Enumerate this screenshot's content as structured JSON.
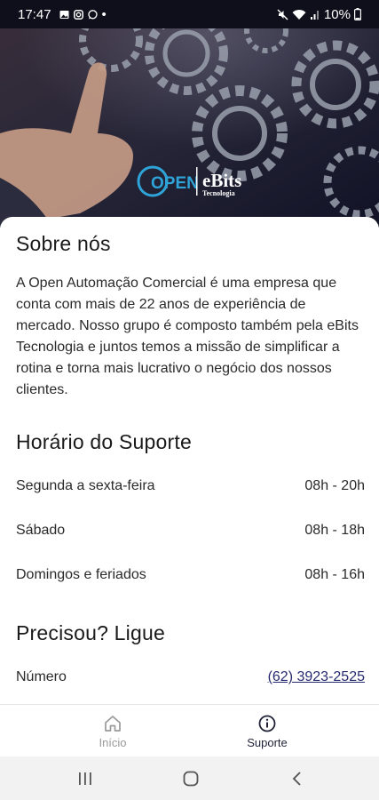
{
  "status_bar": {
    "time": "17:47",
    "dot": "•",
    "battery": "10%",
    "icons": [
      "image-icon",
      "instagram-icon",
      "whatsapp-icon",
      "mute-icon",
      "wifi-icon",
      "signal-icon",
      "battery-icon"
    ]
  },
  "hero": {
    "brand_open": "OPEN",
    "brand_ebits": "eBits",
    "brand_ebits_sub": "Tecnologia"
  },
  "about": {
    "title": "Sobre nós",
    "text": "A Open Automação Comercial é uma empresa que conta com mais de 22 anos de experiência de mercado. Nosso grupo é composto também pela eBits Tecnologia e juntos temos a missão de simplificar a rotina e torna mais lucrativo o negócio dos nossos clientes."
  },
  "support_hours": {
    "title": "Horário do Suporte",
    "rows": [
      {
        "day": "Segunda a sexta-feira",
        "hours": "08h - 20h"
      },
      {
        "day": "Sábado",
        "hours": "08h - 18h"
      },
      {
        "day": "Domingos e feriados",
        "hours": "08h - 16h"
      }
    ]
  },
  "call": {
    "title": "Precisou? Ligue",
    "label": "Número",
    "phone": "(62) 3923-2525"
  },
  "bottom_nav": {
    "items": [
      {
        "label": "Início",
        "icon": "home-icon",
        "active": false
      },
      {
        "label": "Suporte",
        "icon": "info-icon",
        "active": true
      }
    ]
  },
  "colors": {
    "accent": "#262a6e",
    "active_nav": "#1f2237",
    "inactive_nav": "#9a9a9a",
    "hero_bg": "#1c1c2e"
  }
}
